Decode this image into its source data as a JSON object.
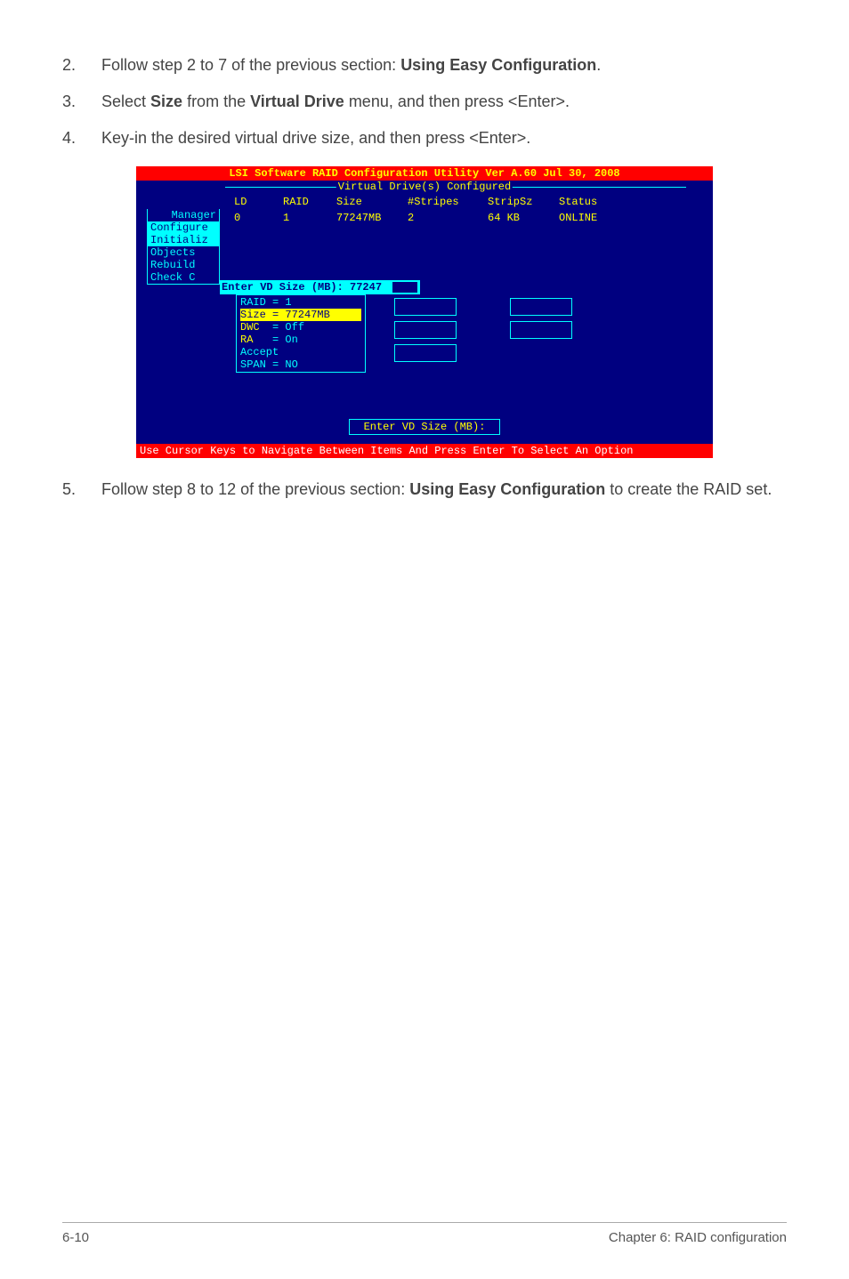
{
  "steps": {
    "s2": {
      "num": "2.",
      "pre": "Follow step 2 to 7 of the previous section: ",
      "bold": "Using Easy Configuration",
      "post": "."
    },
    "s3": {
      "num": "3.",
      "pre": "Select ",
      "b1": "Size",
      "mid": " from the ",
      "b2": "Virtual Drive",
      "post": " menu, and then press <Enter>."
    },
    "s4": {
      "num": "4.",
      "text": "Key-in the desired virtual drive size, and then press <Enter>."
    },
    "s5": {
      "num": "5.",
      "pre": "Follow step 8 to 12 of the previous section: ",
      "bold": "Using Easy Configuration",
      "post": " to create the RAID set."
    }
  },
  "bios": {
    "title": "LSI Software RAID Configuration Utility Ver A.60 Jul 30, 2008",
    "vdHeader": "Virtual Drive(s) Configured",
    "cols": {
      "ld": "LD",
      "raid": "RAID",
      "size": "Size",
      "stripes": "#Stripes",
      "stripsz": "StripSz",
      "status": "Status"
    },
    "row": {
      "ld": "0",
      "raid": "1",
      "size": "77247MB",
      "stripes": "2",
      "stripsz": "64 KB",
      "status": "ONLINE"
    },
    "menu": {
      "manager": "Manager",
      "configure": "Configure",
      "initialize": "Initializ",
      "objects": "Objects",
      "rebuild": "Rebuild",
      "checkc": "Check C"
    },
    "enterSizeLabel": "Enter VD Size (MB): 77247",
    "cfg": {
      "raid": "RAID = 1",
      "size": "Size = 77247MB",
      "dwc_k": "DWC",
      "dwc_v": "  = Off",
      "ra_k": "RA",
      "ra_v": "   = On",
      "accept": "Accept",
      "span": "SPAN = NO"
    },
    "enterVdBox": "Enter VD Size (MB):",
    "footer": "Use Cursor Keys to Navigate Between Items And Press Enter To Select An Option"
  },
  "footer": {
    "left": "6-10",
    "right": "Chapter 6: RAID configuration"
  }
}
